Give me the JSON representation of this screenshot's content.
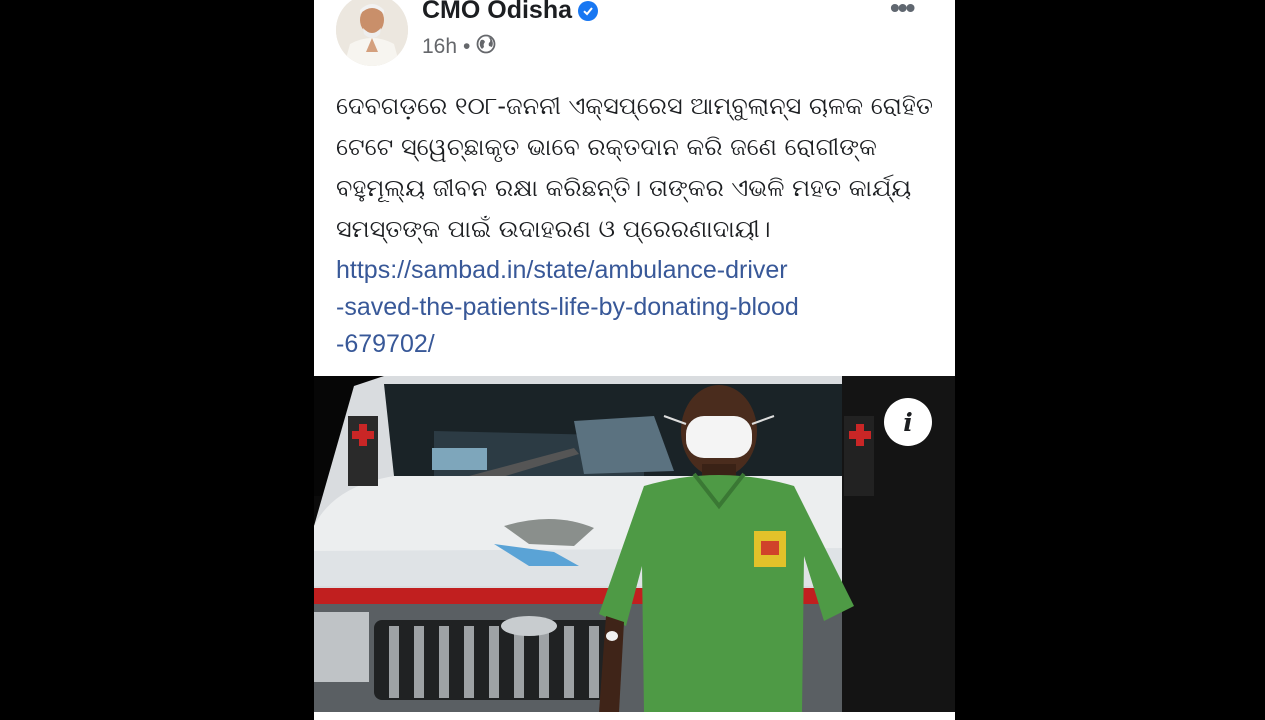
{
  "post": {
    "author": "CMO Odisha",
    "time": "16h",
    "separator": "•",
    "text": "ଦେବଗଡ଼ରେ ୧୦୮-ଜନନୀ ଏକ୍ସପ୍ରେସ ଆମ୍ବୁଲାନ୍ସ ଚାଳକ ରୋହିତ ଟେଟେ ସ୍ୱେଚ୍ଛାକୃତ ଭାବେ ରକ୍ତଦାନ କରି ଜଣେ ରୋଗୀଙ୍କ ବହୁମୂଲ୍ୟ ଜୀବନ ରକ୍ଷା କରିଛନ୍ତି। ତାଙ୍କର ଏଭଳି ମହତ କାର୍ଯ୍ୟ ସମସ୍ତଙ୍କ ପାଇଁ ଉଦାହରଣ ଓ ପ୍ରେରଣାଦାୟୀ।",
    "link": "https://sambad.in/state/ambulance-driver\n-saved-the-patients-life-by-donating-blood\n-679702/",
    "more_icon": "more-horizontal-icon",
    "audience_icon": "globe-icon",
    "verified_icon": "verified-badge-icon",
    "info_label": "i"
  },
  "colors": {
    "background": "#000000",
    "card": "#ffffff",
    "link": "#385898",
    "verified": "#1877f2",
    "muted_text": "#65676b"
  }
}
